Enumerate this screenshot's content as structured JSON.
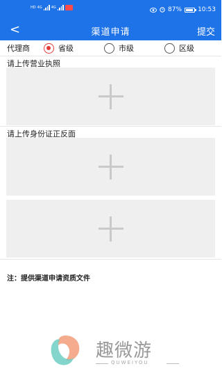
{
  "status_bar": {
    "left_small_1": "HD",
    "left_small_2": "4G",
    "left_small_3": "4G",
    "battery_percent": "87%",
    "time": "10:53",
    "icons": [
      "eye-icon",
      "alarm-icon",
      "battery-icon"
    ]
  },
  "header": {
    "back_icon": "<",
    "title": "渠道申请",
    "submit_label": "提交"
  },
  "agent": {
    "label": "代理商",
    "options": [
      {
        "label": "省级",
        "selected": true
      },
      {
        "label": "市级",
        "selected": false
      },
      {
        "label": "区级",
        "selected": false
      }
    ]
  },
  "uploads": {
    "business_license_label": "请上传营业执照",
    "id_card_label": "请上传身份证正反面"
  },
  "note": "注：提供渠道申请资质文件",
  "watermark": {
    "name": "趣微游",
    "sub": "QUWEIYOU"
  },
  "colors": {
    "primary": "#1e73e8",
    "radio_selected": "#e53935",
    "upload_bg": "#efefef"
  }
}
